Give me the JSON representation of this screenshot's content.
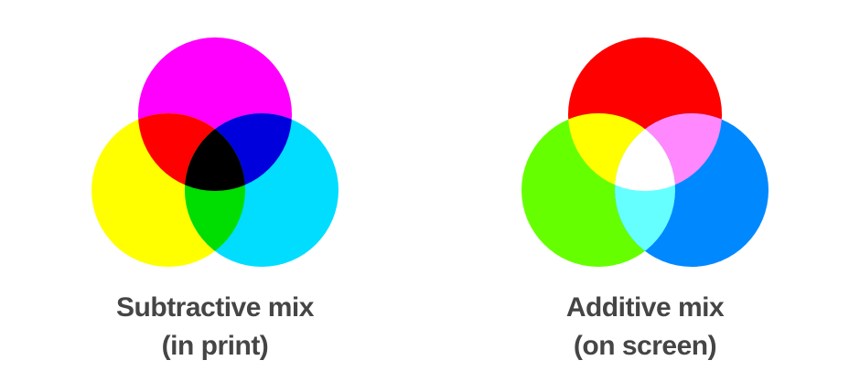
{
  "diagrams": [
    {
      "id": "subtractive",
      "caption": [
        "Subtractive mix",
        "(in print)"
      ],
      "circles": [
        {
          "name": "magenta",
          "color": "#ff00ff"
        },
        {
          "name": "yellow",
          "color": "#ffff00"
        },
        {
          "name": "cyan",
          "color": "#00ddff"
        }
      ],
      "overlaps": {
        "top_left": "#ff0000",
        "top_right": "#0000dd",
        "bottom": "#00dd00",
        "center": "#000000"
      }
    },
    {
      "id": "additive",
      "caption": [
        "Additive mix",
        "(on screen)"
      ],
      "circles": [
        {
          "name": "red",
          "color": "#ff0000"
        },
        {
          "name": "green",
          "color": "#66ff00"
        },
        {
          "name": "blue",
          "color": "#0088ff"
        }
      ],
      "overlaps": {
        "top_left": "#ffff00",
        "top_right": "#ff88ff",
        "bottom": "#66ffff",
        "center": "#ffffff"
      }
    }
  ]
}
